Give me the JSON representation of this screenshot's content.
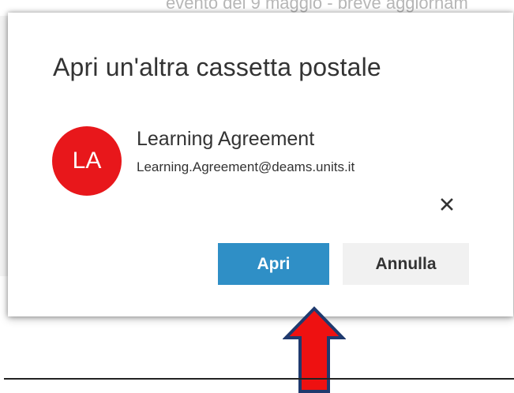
{
  "background": {
    "snippet_text": "evento del 9 maggio - breve aggiornam"
  },
  "dialog": {
    "title": "Apri un'altra cassetta postale",
    "mailbox": {
      "initials": "LA",
      "name": "Learning Agreement",
      "email": "Learning.Agreement@deams.units.it",
      "avatar_color": "#e8171b"
    },
    "remove_icon": "close-icon",
    "buttons": {
      "open_label": "Apri",
      "cancel_label": "Annulla"
    }
  },
  "annotation": {
    "arrow_icon": "up-arrow-icon",
    "arrow_fill": "#ee1111",
    "arrow_outline": "#1f3a6e"
  },
  "colors": {
    "primary_button": "#2f8fc6",
    "secondary_button": "#f1f1f1",
    "text": "#333333"
  }
}
